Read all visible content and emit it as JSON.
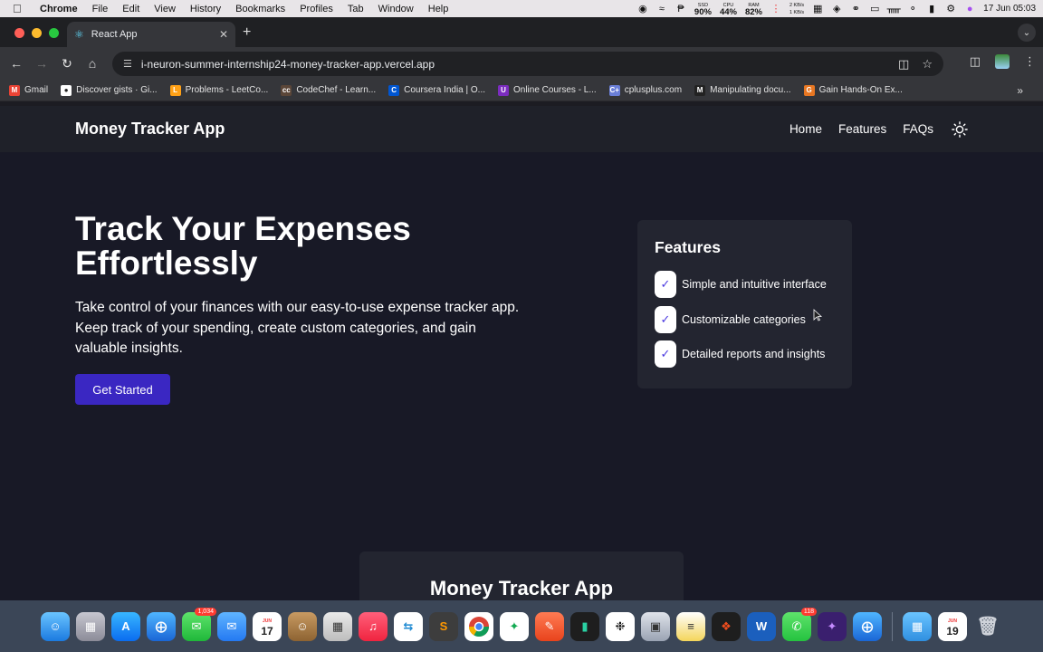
{
  "menubar": {
    "app": "Chrome",
    "items": [
      "File",
      "Edit",
      "View",
      "History",
      "Bookmarks",
      "Profiles",
      "Tab",
      "Window",
      "Help"
    ],
    "ssd": {
      "label": "SSD",
      "value": "90%"
    },
    "cpu": {
      "label": "CPU",
      "value": "44%"
    },
    "ram": {
      "label": "RAM",
      "value": "82%"
    },
    "net": {
      "up": "2 KB/s",
      "down": "1 KB/s"
    },
    "datetime": "17 Jun  05:03"
  },
  "browser": {
    "tab_title": "React App",
    "url": "i-neuron-summer-internship24-money-tracker-app.vercel.app",
    "bookmarks": [
      {
        "label": "Gmail",
        "color": "#ea4335",
        "glyph": "M"
      },
      {
        "label": "Discover gists · Gi...",
        "color": "#ffffff",
        "glyph": "●"
      },
      {
        "label": "Problems - LeetCo...",
        "color": "#ffa116",
        "glyph": "L"
      },
      {
        "label": "CodeChef - Learn...",
        "color": "#5b4638",
        "glyph": "cc"
      },
      {
        "label": "Coursera India | O...",
        "color": "#0056d2",
        "glyph": "C"
      },
      {
        "label": "Online Courses - L...",
        "color": "#7b2cbf",
        "glyph": "U"
      },
      {
        "label": "cplusplus.com",
        "color": "#6a7fd8",
        "glyph": "C+"
      },
      {
        "label": "Manipulating docu...",
        "color": "#222222",
        "glyph": "M"
      },
      {
        "label": "Gain Hands-On Ex...",
        "color": "#e87722",
        "glyph": "G"
      }
    ]
  },
  "site": {
    "brand": "Money Tracker App",
    "nav": {
      "home": "Home",
      "features": "Features",
      "faqs": "FAQs"
    },
    "hero": {
      "title": "Track Your Expenses Effortlessly",
      "description": "Take control of your finances with our easy-to-use expense tracker app. Keep track of your spending, create custom categories, and gain valuable insights.",
      "cta": "Get Started"
    },
    "features": {
      "title": "Features",
      "check": "✓",
      "items": [
        "Simple and intuitive interface",
        "Customizable categories",
        "Detailed reports and insights"
      ]
    },
    "footer_card_title": "Money Tracker App"
  },
  "dock": {
    "messages_badge": "1,034",
    "whatsapp_badge": "118",
    "calendar_day": "17",
    "calendar_month": "JUN",
    "calendar2_day": "19"
  },
  "colors": {
    "accent": "#3a27c2",
    "check": "#4c3be0",
    "page_bg": "#181926",
    "card_bg": "#232530"
  }
}
